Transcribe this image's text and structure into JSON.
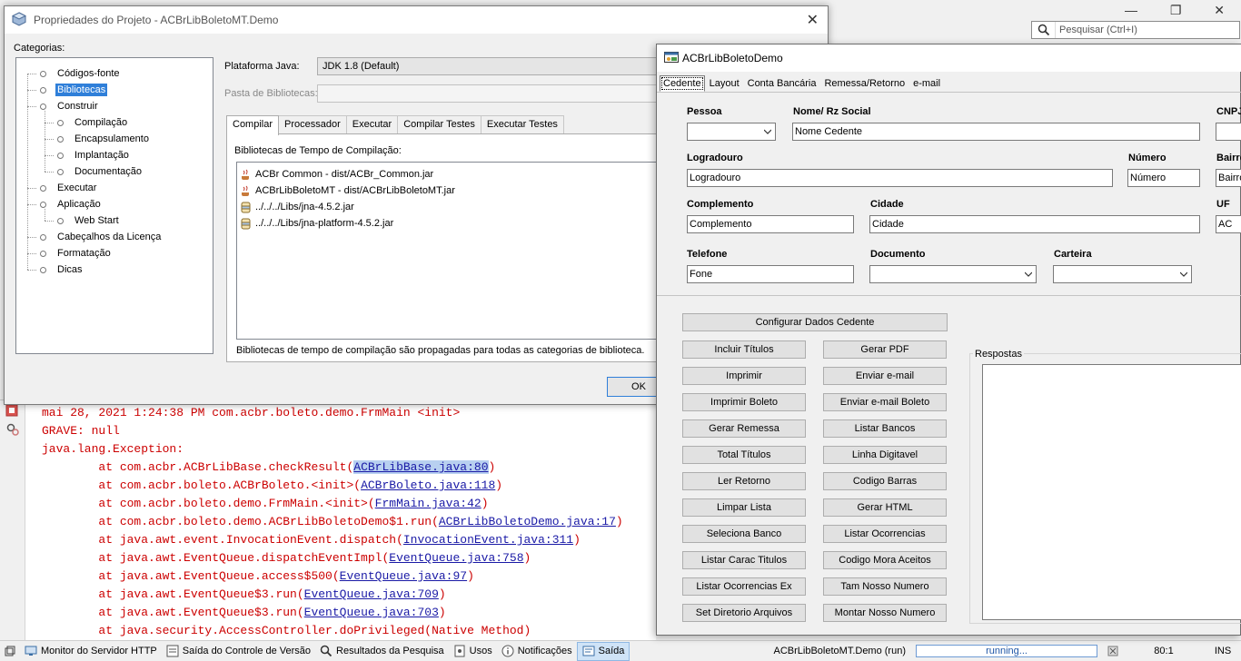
{
  "ide": {
    "search_placeholder": "Pesquisar (Ctrl+I)",
    "window_controls": {
      "minimize": "—",
      "restore": "❐",
      "close": "✕"
    },
    "output_lines": [
      {
        "text": "mai 28, 2021 1:24:38 PM com.acbr.boleto.demo.FrmMain <init>"
      },
      {
        "text": "GRAVE: null"
      },
      {
        "text": "java.lang.Exception:"
      },
      {
        "prefix": "        at com.acbr.ACBrLibBase.checkResult(",
        "link": "ACBrLibBase.java:80",
        "suffix": ")",
        "selected": true
      },
      {
        "prefix": "        at com.acbr.boleto.ACBrBoleto.<init>(",
        "link": "ACBrBoleto.java:118",
        "suffix": ")"
      },
      {
        "prefix": "        at com.acbr.boleto.demo.FrmMain.<init>(",
        "link": "FrmMain.java:42",
        "suffix": ")"
      },
      {
        "prefix": "        at com.acbr.boleto.demo.ACBrLibBoletoDemo$1.run(",
        "link": "ACBrLibBoletoDemo.java:17",
        "suffix": ")"
      },
      {
        "prefix": "        at java.awt.event.InvocationEvent.dispatch(",
        "link": "InvocationEvent.java:311",
        "suffix": ")"
      },
      {
        "prefix": "        at java.awt.EventQueue.dispatchEventImpl(",
        "link": "EventQueue.java:758",
        "suffix": ")"
      },
      {
        "prefix": "        at java.awt.EventQueue.access$500(",
        "link": "EventQueue.java:97",
        "suffix": ")"
      },
      {
        "prefix": "        at java.awt.EventQueue$3.run(",
        "link": "EventQueue.java:709",
        "suffix": ")"
      },
      {
        "prefix": "        at java.awt.EventQueue$3.run(",
        "link": "EventQueue.java:703",
        "suffix": ")"
      },
      {
        "text": "        at java.security.AccessController.doPrivileged(Native Method)"
      }
    ],
    "statusbar": {
      "items": [
        {
          "name": "monitor-servidor-http",
          "label": "Monitor do Servidor HTTP",
          "icon": "server-monitor-icon"
        },
        {
          "name": "saida-controle-versao",
          "label": "Saída do Controle de Versão",
          "icon": "version-control-icon"
        },
        {
          "name": "resultados-pesquisa",
          "label": "Resultados da Pesquisa",
          "icon": "search-results-icon"
        },
        {
          "name": "usos",
          "label": "Usos",
          "icon": "usages-icon"
        },
        {
          "name": "notificacoes",
          "label": "Notificações",
          "icon": "notifications-icon"
        },
        {
          "name": "saida",
          "label": "Saída",
          "icon": "output-icon",
          "active": true
        }
      ],
      "running_task": "ACBrLibBoletoMT.Demo (run)",
      "progress_text": "running...",
      "position": "80:1",
      "insert_mode": "INS"
    }
  },
  "props_dialog": {
    "title": "Propriedades do Projeto - ACBrLibBoletoMT.Demo",
    "categories_label": "Categorias:",
    "categories": [
      {
        "label": "Códigos-fonte",
        "level": 0
      },
      {
        "label": "Bibliotecas",
        "level": 0,
        "selected": true
      },
      {
        "label": "Construir",
        "level": 0
      },
      {
        "label": "Compilação",
        "level": 1
      },
      {
        "label": "Encapsulamento",
        "level": 1
      },
      {
        "label": "Implantação",
        "level": 1
      },
      {
        "label": "Documentação",
        "level": 1
      },
      {
        "label": "Executar",
        "level": 0
      },
      {
        "label": "Aplicação",
        "level": 0
      },
      {
        "label": "Web Start",
        "level": 1
      },
      {
        "label": "Cabeçalhos da Licença",
        "level": 0
      },
      {
        "label": "Formatação",
        "level": 0
      },
      {
        "label": "Dicas",
        "level": 0
      }
    ],
    "plataforma_label": "Plataforma Java:",
    "plataforma_value": "JDK 1.8 (Default)",
    "pasta_label": "Pasta de Bibliotecas:",
    "pasta_value": "",
    "tabs": [
      "Compilar",
      "Processador",
      "Executar",
      "Compilar Testes",
      "Executar Testes"
    ],
    "active_tab": 0,
    "libs_label": "Bibliotecas de Tempo de Compilação:",
    "libs": [
      {
        "label": "ACBr Common - dist/ACBr_Common.jar",
        "icon": "java-project-icon"
      },
      {
        "label": "ACBrLibBoletoMT - dist/ACBrLibBoletoMT.jar",
        "icon": "java-project-icon"
      },
      {
        "label": "../../../Libs/jna-4.5.2.jar",
        "icon": "jar-file-icon"
      },
      {
        "label": "../../../Libs/jna-platform-4.5.2.jar",
        "icon": "jar-file-icon"
      }
    ],
    "libs_note": "Bibliotecas de tempo de compilação são propagadas para todas as categorias de biblioteca.",
    "ok_label": "OK",
    "close_label": "✕"
  },
  "demo": {
    "title": "ACBrLibBoletoDemo",
    "tabs": [
      "Cedente",
      "Layout",
      "Conta Bancária",
      "Remessa/Retorno",
      "e-mail"
    ],
    "active_tab": 0,
    "labels": {
      "pessoa": "Pessoa",
      "nome": "Nome/ Rz Social",
      "cnpj": "CNPJ",
      "logradouro": "Logradouro",
      "numero": "Número",
      "bairro": "Bairro",
      "complemento": "Complemento",
      "cidade": "Cidade",
      "uf": "UF",
      "telefone": "Telefone",
      "documento": "Documento",
      "carteira": "Carteira"
    },
    "values": {
      "pessoa": "",
      "nome": "Nome Cedente",
      "cnpj": "",
      "logradouro": "Logradouro",
      "numero": "Número",
      "bairro": "Bairro",
      "complemento": "Complemento",
      "cidade": "Cidade",
      "uf": "AC",
      "telefone": "Fone",
      "documento": "",
      "carteira": ""
    },
    "buttons": {
      "configurar": "Configurar Dados Cedente",
      "left": [
        "Incluir Títulos",
        "Imprimir",
        "Imprimir Boleto",
        "Gerar Remessa",
        "Total Títulos",
        "Ler Retorno",
        "Limpar Lista",
        "Seleciona Banco",
        "Listar Carac Titulos",
        "Listar Ocorrencias Ex",
        "Set Diretorio Arquivos"
      ],
      "right": [
        "Gerar PDF",
        "Enviar e-mail",
        "Enviar e-mail Boleto",
        "Listar Bancos",
        "Linha Digitavel",
        "Codigo Barras",
        "Gerar HTML",
        "Listar Ocorrencias",
        "Codigo Mora Aceitos",
        "Tam Nosso Numero",
        "Montar Nosso Numero"
      ]
    },
    "respostas_label": "Respostas",
    "respostas_value": ""
  }
}
